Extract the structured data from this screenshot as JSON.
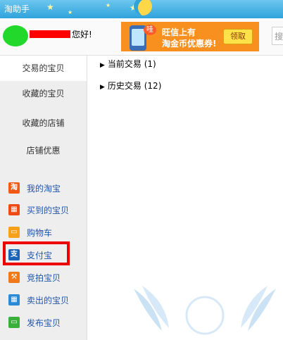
{
  "window": {
    "title": "淘助手"
  },
  "header": {
    "greeting": "您好!"
  },
  "ad": {
    "bubble": "哇",
    "line1": "旺信上有",
    "line2": "淘金币优惠券!",
    "claim_label": "领取"
  },
  "search_stub": {
    "text": "搜"
  },
  "sidebar": {
    "nav_items": [
      {
        "label": "交易的宝贝",
        "active": true
      },
      {
        "label": "收藏的宝贝",
        "active": false
      },
      {
        "label": "收藏的店铺",
        "active": false
      },
      {
        "label": "店铺优惠",
        "active": false
      }
    ],
    "apps": [
      {
        "label": "我的淘宝",
        "icon": "taobao-icon",
        "color": "#f05a14"
      },
      {
        "label": "买到的宝贝",
        "icon": "gift-icon",
        "color": "#f04a14"
      },
      {
        "label": "购物车",
        "icon": "cart-icon",
        "color": "#f7a01a"
      },
      {
        "label": "支付宝",
        "icon": "alipay-icon",
        "color": "#1c64b8"
      },
      {
        "label": "竞拍宝贝",
        "icon": "auction-hammer-icon",
        "color": "#f07a1a"
      },
      {
        "label": "卖出的宝贝",
        "icon": "grid-icon",
        "color": "#2a8ad6"
      },
      {
        "label": "发布宝贝",
        "icon": "monitor-icon",
        "color": "#3ab03a"
      }
    ]
  },
  "main": {
    "tree": [
      {
        "label": "当前交易 (1)"
      },
      {
        "label": "历史交易 (12)"
      }
    ]
  }
}
